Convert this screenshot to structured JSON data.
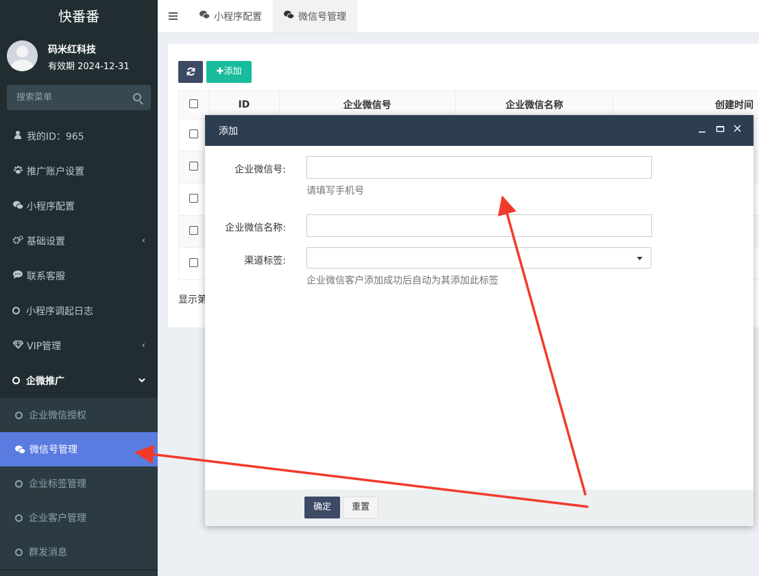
{
  "sidebar": {
    "brand": "快番番",
    "user": {
      "name": "码米红科技",
      "expire": "有效期 2024-12-31"
    },
    "search_placeholder": "搜索菜单",
    "items": [
      {
        "label": "我的ID：965",
        "icon": "user-icon"
      },
      {
        "label": "推广账户设置",
        "icon": "paw-icon"
      },
      {
        "label": "小程序配置",
        "icon": "wechat-icon"
      },
      {
        "label": "基础设置",
        "icon": "cogs-icon",
        "caret": "‹"
      },
      {
        "label": "联系客服",
        "icon": "comment-icon"
      },
      {
        "label": "小程序调起日志",
        "icon": "circle-icon"
      },
      {
        "label": "VIP管理",
        "icon": "diamond-icon",
        "caret": "‹"
      },
      {
        "label": "企微推广",
        "icon": "circle-icon",
        "caret": "⌄"
      }
    ],
    "submenu": [
      {
        "label": "企业微信授权",
        "icon": "circle-icon"
      },
      {
        "label": "微信号管理",
        "icon": "wechat-icon",
        "active": true
      },
      {
        "label": "企业标签管理",
        "icon": "circle-icon"
      },
      {
        "label": "企业客户管理",
        "icon": "circle-icon"
      },
      {
        "label": "群发消息",
        "icon": "circle-icon"
      }
    ]
  },
  "topbar": {
    "tabs": [
      {
        "label": "小程序配置",
        "icon": "wechat-icon"
      },
      {
        "label": "微信号管理",
        "icon": "wechat-icon",
        "active": true
      }
    ]
  },
  "content": {
    "add_label": "添加",
    "columns": [
      "ID",
      "企业微信号",
      "企业微信名称",
      "创建时间"
    ],
    "row_count": 5,
    "footer": "显示第"
  },
  "modal": {
    "title": "添加",
    "fields": {
      "wechat_id": {
        "label": "企业微信号:",
        "value": "",
        "help": "请填写手机号"
      },
      "wechat_name": {
        "label": "企业微信名称:",
        "value": ""
      },
      "channel_tag": {
        "label": "渠道标签:",
        "value": "",
        "help": "企业微信客户添加成功后自动为其添加此标签"
      }
    },
    "ok_label": "确定",
    "reset_label": "重置"
  },
  "colors": {
    "sidebar_bg": "#222d32",
    "active_menu": "#5a7be0",
    "modal_header": "#2e3e52",
    "add_button": "#18bc9c",
    "primary_button": "#3c4a66",
    "annotation_arrow": "#f23a2b"
  }
}
